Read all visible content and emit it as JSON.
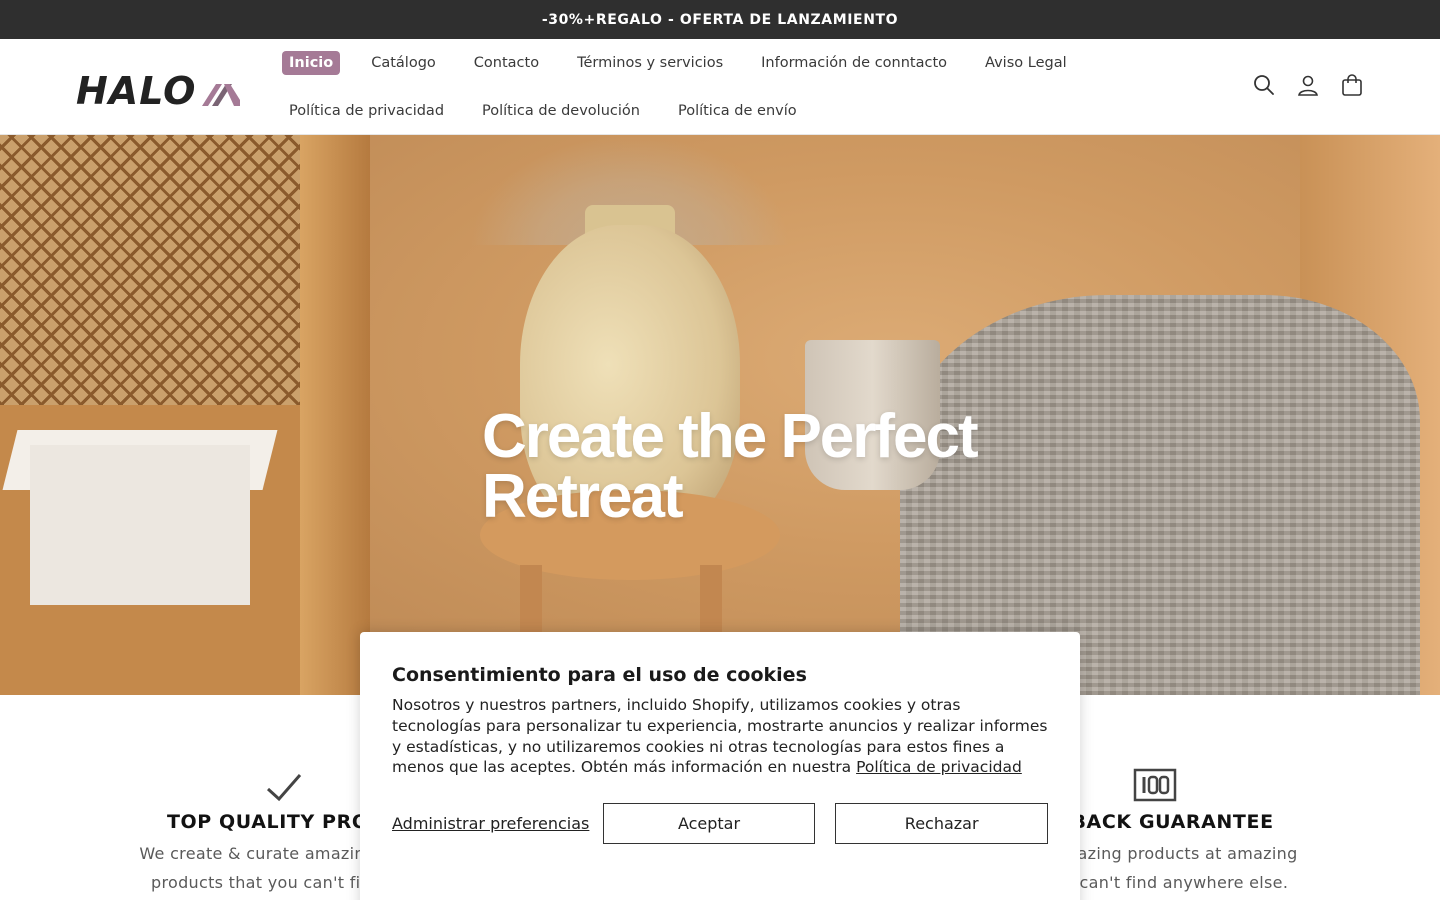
{
  "announcement": {
    "text": "-30%+REGALO - OFERTA DE LANZAMIENTO"
  },
  "brand": {
    "logo_text": "HALO",
    "accent_color": "#a57a96"
  },
  "nav": {
    "row1": [
      "Inicio",
      "Catálogo",
      "Contacto",
      "Términos y servicios",
      "Información de conntacto",
      "Aviso Legal"
    ],
    "row2": [
      "Política de privacidad",
      "Política de devolución",
      "Política de envío"
    ],
    "active": "Inicio"
  },
  "header_icons": [
    "search-icon",
    "account-icon",
    "cart-icon"
  ],
  "hero": {
    "title_line1": "Create the Perfect",
    "title_line2": "Retreat"
  },
  "features": [
    {
      "icon": "checkmark-icon",
      "title": "TOP QUALITY PRODU",
      "text_line1": "We create & curate amazing produ",
      "text_line2": "products that you can't find any"
    },
    {
      "icon": "100-badge-icon",
      "title": "EY BACK GUARANTEE",
      "text_line1": "rate amazing products at amazing",
      "text_line2": "at you can't find anywhere else."
    }
  ],
  "cookie": {
    "title": "Consentimiento para el uso de cookies",
    "body": "Nosotros y nuestros partners, incluido Shopify, utilizamos cookies y otras tecnologías para personalizar tu experiencia, mostrarte anuncios y realizar informes y estadísticas, y no utilizaremos cookies ni otras tecnologías para estos fines a menos que las aceptes. Obtén más información en nuestra",
    "link": "Política de privacidad",
    "manage": "Administrar preferencias",
    "accept": "Aceptar",
    "reject": "Rechazar"
  }
}
